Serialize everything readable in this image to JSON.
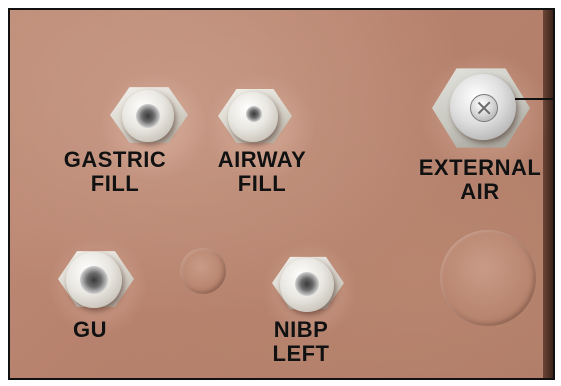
{
  "labels": {
    "gastric_fill": "GASTRIC\nFILL",
    "airway_fill": "AIRWAY\nFILL",
    "external_air": "EXTERNAL\nAIR",
    "gu": "GU",
    "nibp_left": "NIBP\nLEFT"
  },
  "colors": {
    "panel": "#b7826d",
    "connector": "#e9e7e1",
    "label": "#111111"
  }
}
